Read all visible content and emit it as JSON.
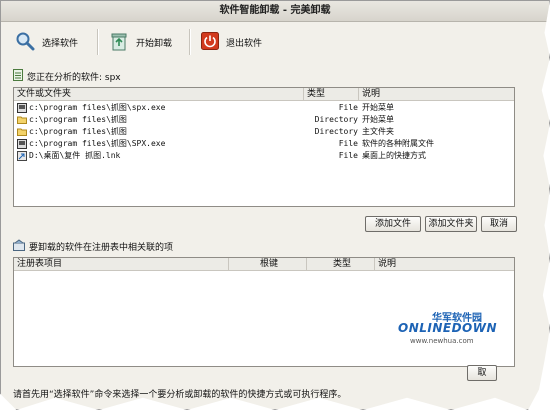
{
  "window": {
    "title": "软件智能卸载 - 完美卸载"
  },
  "toolbar": {
    "select_label": "选择软件",
    "start_label": "开始卸载",
    "exit_label": "退出软件"
  },
  "analysis": {
    "label": "您正在分析的软件: spx",
    "columns": [
      "文件或文件夹",
      "类型",
      "说明"
    ],
    "rows": [
      {
        "path": "c:\\program files\\抓图\\spx.exe",
        "type": "File",
        "desc": "开始菜单",
        "icon": "exe-icon"
      },
      {
        "path": "c:\\program files\\抓图",
        "type": "Directory",
        "desc": "开始菜单",
        "icon": "folder-icon"
      },
      {
        "path": "c:\\program files\\抓图",
        "type": "Directory",
        "desc": "主文件夹",
        "icon": "folder-icon"
      },
      {
        "path": "c:\\program files\\抓图\\SPX.exe",
        "type": "File",
        "desc": "软件的各种附属文件",
        "icon": "exe-icon"
      },
      {
        "path": "D:\\桌面\\复件 抓图.lnk",
        "type": "File",
        "desc": "桌面上的快捷方式",
        "icon": "shortcut-icon"
      }
    ],
    "buttons": {
      "add_file": "添加文件",
      "add_folder": "添加文件夹",
      "cancel": "取消"
    }
  },
  "registry": {
    "label": "要卸载的软件在注册表中相关联的项",
    "columns": [
      "注册表项目",
      "根键",
      "类型",
      "说明"
    ],
    "rows": []
  },
  "footer": {
    "status": "请首先用“选择软件”命令来选择一个要分析或卸载的软件的快捷方式或可执行程序。",
    "button": "取"
  },
  "watermark": {
    "cn": "华军软件园",
    "brand": "ONLINEDOWN",
    "url": "www.newhua.com"
  },
  "colors": {
    "accent_red": "#d23a1e",
    "brand_blue": "#1d63b5"
  }
}
